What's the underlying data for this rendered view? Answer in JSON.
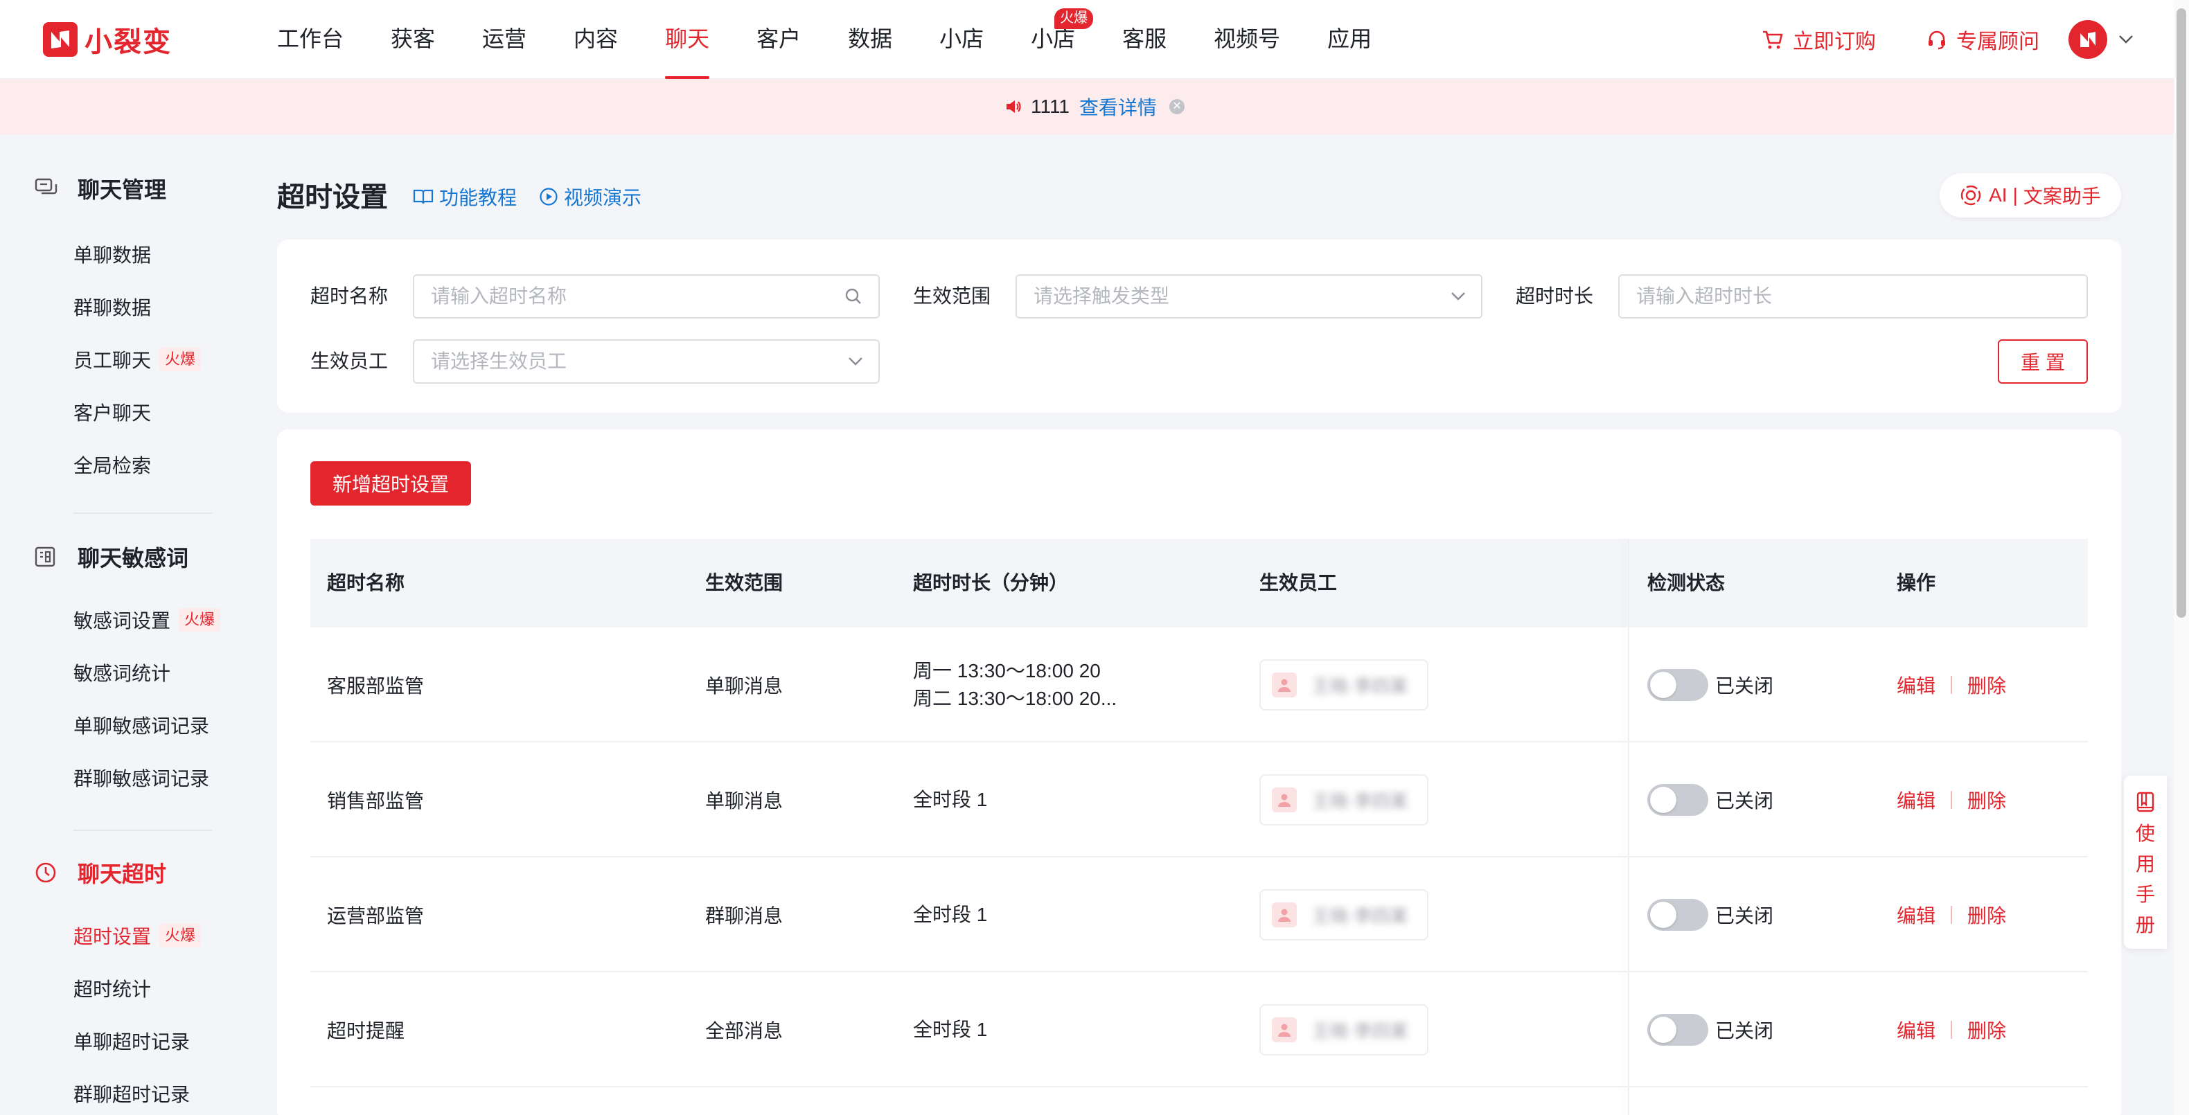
{
  "brand": {
    "name": "小裂变",
    "color": "#e3262e"
  },
  "nav": {
    "items": [
      "工作台",
      "获客",
      "运营",
      "内容",
      "聊天",
      "客户",
      "数据",
      "小店",
      "小店",
      "客服",
      "视频号",
      "应用"
    ],
    "active": "聊天",
    "badge": "火爆",
    "subscribe": "立即订购",
    "advisor": "专属顾问"
  },
  "notice": {
    "text": "1111",
    "link": "查看详情"
  },
  "sidebar": {
    "groups": [
      {
        "title": "聊天管理",
        "icon": "chat-icon",
        "items": [
          {
            "label": "单聊数据"
          },
          {
            "label": "群聊数据"
          },
          {
            "label": "员工聊天",
            "hot": "火爆"
          },
          {
            "label": "客户聊天"
          },
          {
            "label": "全局检索"
          }
        ]
      },
      {
        "title": "聊天敏感词",
        "icon": "sensitive-word-icon",
        "items": [
          {
            "label": "敏感词设置",
            "hot": "火爆"
          },
          {
            "label": "敏感词统计"
          },
          {
            "label": "单聊敏感词记录"
          },
          {
            "label": "群聊敏感词记录"
          }
        ]
      },
      {
        "title": "聊天超时",
        "icon": "clock-icon",
        "items": [
          {
            "label": "超时设置",
            "hot": "火爆"
          },
          {
            "label": "超时统计"
          },
          {
            "label": "单聊超时记录"
          },
          {
            "label": "群聊超时记录"
          }
        ]
      }
    ]
  },
  "page": {
    "title": "超时设置",
    "tutorial": "功能教程",
    "video": "视频演示",
    "ai_label": "AI",
    "ai_assistant": "文案助手"
  },
  "filters": {
    "name_label": "超时名称",
    "name_placeholder": "请输入超时名称",
    "scope_label": "生效范围",
    "scope_placeholder": "请选择触发类型",
    "duration_label": "超时时长",
    "duration_placeholder": "请输入超时时长",
    "staff_label": "生效员工",
    "staff_placeholder": "请选择生效员工",
    "reset": "重置"
  },
  "table": {
    "add_button": "新增超时设置",
    "columns": [
      "超时名称",
      "生效范围",
      "超时时长（分钟）",
      "生效员工",
      "检测状态",
      "操作"
    ],
    "rows": [
      {
        "name": "客服部监管",
        "scope": "单聊消息",
        "duration": [
          "周一 13:30～18:00 20",
          "周二 13:30～18:00 20..."
        ],
        "staff": "王晓·李四某",
        "status": "已关闭",
        "edit": "编辑",
        "delete": "删除"
      },
      {
        "name": "销售部监管",
        "scope": "单聊消息",
        "duration": [
          "全时段 1"
        ],
        "staff": "王晓·李四某",
        "status": "已关闭",
        "edit": "编辑",
        "delete": "删除"
      },
      {
        "name": "运营部监管",
        "scope": "群聊消息",
        "duration": [
          "全时段 1"
        ],
        "staff": "王晓·李四某",
        "status": "已关闭",
        "edit": "编辑",
        "delete": "删除"
      },
      {
        "name": "超时提醒",
        "scope": "全部消息",
        "duration": [
          "全时段 1"
        ],
        "staff": "王晓·李四某",
        "status": "已关闭",
        "edit": "编辑",
        "delete": "删除"
      }
    ]
  },
  "manual": {
    "chars": [
      "使",
      "用",
      "手",
      "册"
    ]
  }
}
